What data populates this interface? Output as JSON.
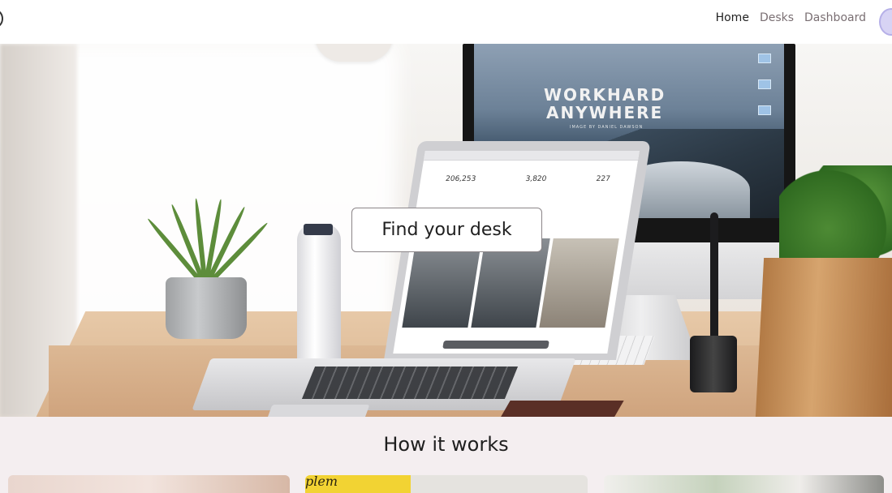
{
  "header": {
    "nav": [
      {
        "label": "Home",
        "active": true
      },
      {
        "label": "Desks",
        "active": false
      },
      {
        "label": "Dashboard",
        "active": false
      }
    ]
  },
  "hero": {
    "cta_label": "Find your desk",
    "monitor_wallpaper": {
      "title_line1": "WORKHARD",
      "title_line2": "ANYWHERE",
      "subtitle": "IMAGE BY DANIEL DAWSON"
    },
    "laptop_stats": [
      "206,253",
      "3,820",
      "227"
    ]
  },
  "how_it_works": {
    "title": "How it works",
    "card_2_text": "plem"
  },
  "colors": {
    "page_bg": "#f4eef0",
    "header_bg": "#ffffff",
    "nav_active": "#222222",
    "nav_inactive": "#7a6f73",
    "avatar": "#d7d3f4"
  }
}
